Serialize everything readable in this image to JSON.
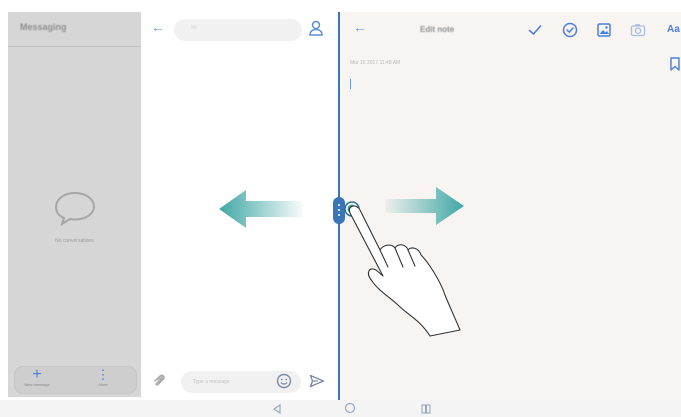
{
  "messaging": {
    "title": "Messaging",
    "empty_text": "No conversations",
    "new_message_label": "New message",
    "more_label": "More"
  },
  "chat": {
    "recipient_placeholder": "To",
    "message_placeholder": "Type a message"
  },
  "note": {
    "title": "Edit note",
    "date": "Mar 16 2017 11:48 AM",
    "font_label": "Aa"
  },
  "colors": {
    "accent": "#3b75b9",
    "arrow_teal": "#3fa7a4",
    "icon_blue": "#4a7fe0"
  },
  "icons": [
    "back-arrow-icon",
    "contact-icon",
    "attachment-icon",
    "emoji-icon",
    "send-icon",
    "checkmark-icon",
    "checklist-icon",
    "gallery-icon",
    "camera-icon",
    "bookmark-icon",
    "chat-bubble-icon",
    "plus-icon",
    "more-vertical-icon",
    "nav-back-icon",
    "nav-home-icon",
    "nav-recents-icon"
  ]
}
